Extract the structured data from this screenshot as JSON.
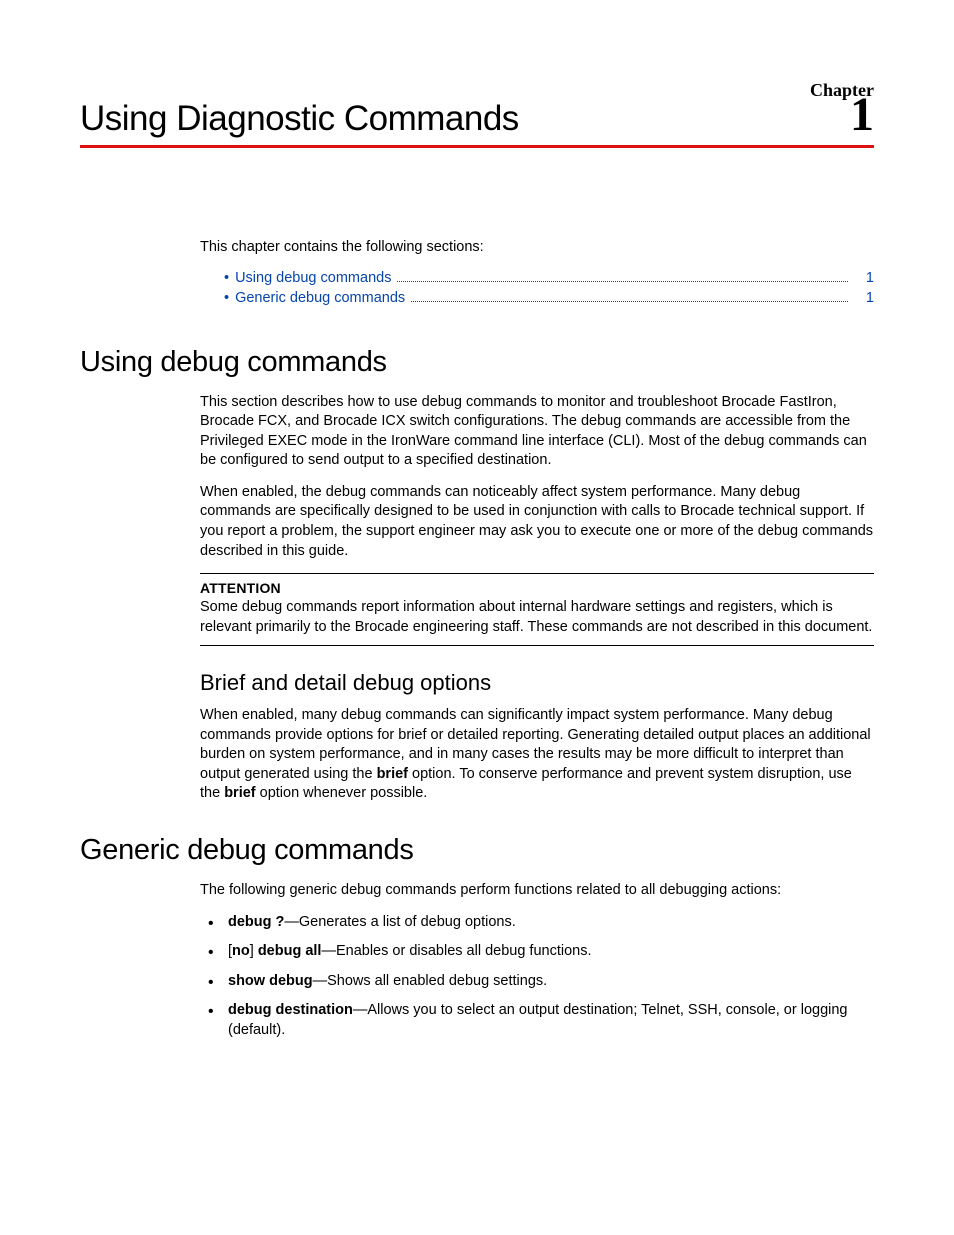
{
  "header": {
    "chapter_label": "Chapter",
    "title": "Using Diagnostic Commands",
    "chapter_number": "1"
  },
  "intro": {
    "lead": "This chapter contains the following sections:",
    "toc": [
      {
        "label": "Using debug commands",
        "page": "1"
      },
      {
        "label": "Generic debug commands",
        "page": "1"
      }
    ]
  },
  "section1": {
    "heading": "Using debug commands",
    "para1": "This section describes how to use debug commands to monitor and troubleshoot Brocade FastIron, Brocade FCX, and Brocade ICX switch configurations. The debug commands are accessible from the Privileged EXEC mode in the IronWare command line interface (CLI). Most of the debug commands can be configured to send output to a specified destination.",
    "para2": "When enabled, the debug commands can noticeably affect system performance. Many debug commands are specifically designed to be used in conjunction with calls to Brocade technical support. If you report a problem, the support engineer may ask you to execute one or more of the debug commands described in this guide.",
    "attention_head": "ATTENTION",
    "attention_body": "Some debug commands report information about internal hardware settings and registers, which is relevant primarily to the Brocade engineering staff. These commands are not described in this document.",
    "sub_heading": "Brief and detail debug options",
    "sub_para_pre": "When enabled, many debug commands can significantly impact system performance. Many debug commands provide options for brief or detailed reporting. Generating detailed output places an additional burden on system performance, and in many cases the results may be more difficult to interpret than output generated using the ",
    "sub_para_bold1": "brief",
    "sub_para_mid": " option. To conserve performance and prevent system disruption, use the ",
    "sub_para_bold2": "brief",
    "sub_para_post": " option whenever possible."
  },
  "section2": {
    "heading": "Generic debug commands",
    "lead": "The following generic debug commands perform functions related to all debugging actions:",
    "items": [
      {
        "cmd": "debug ?",
        "desc": "—Generates a list of debug options."
      },
      {
        "pre": "[",
        "bold1": "no",
        "mid1": "] ",
        "cmd": "debug all",
        "desc": "—Enables or disables all debug functions."
      },
      {
        "cmd": "show debug",
        "desc": "—Shows all enabled debug settings."
      },
      {
        "cmd": "debug destination",
        "desc": "—Allows you to select an output destination; Telnet, SSH, console, or logging (default)."
      }
    ]
  }
}
